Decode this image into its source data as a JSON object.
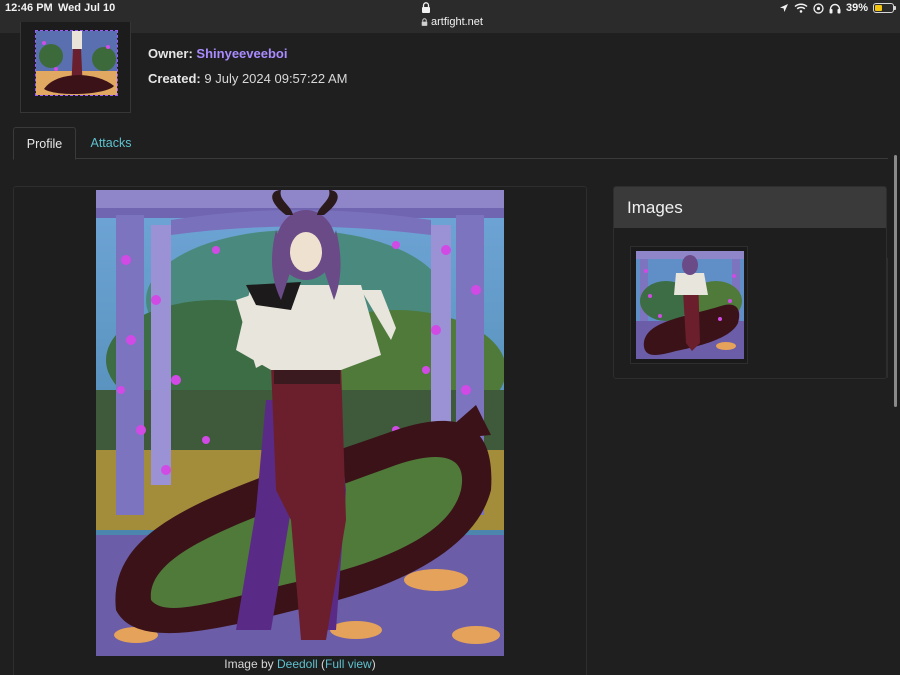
{
  "status_bar": {
    "time": "12:46 PM",
    "date": "Wed Jul 10",
    "url": "artfight.net",
    "battery": "39%",
    "battery_level": 0.39,
    "icons": [
      "location-icon",
      "wifi-icon",
      "hotspot-icon",
      "headphones-icon",
      "battery-icon",
      "lock-icon"
    ]
  },
  "header": {
    "owner_label": "Owner:",
    "owner_name": "Shinyeeveeboi",
    "created_label": "Created:",
    "created_value": "9 July 2024 09:57:22 AM"
  },
  "tabs": [
    {
      "label": "Profile",
      "active": true
    },
    {
      "label": "Attacks",
      "active": false
    }
  ],
  "main": {
    "caption_prefix": "Image by ",
    "artist": "Deedoll",
    "full_view": "Full view",
    "paren_open": "(",
    "paren_close": ")"
  },
  "sidebar": {
    "title": "Images"
  },
  "colors": {
    "accent_link": "#5fc1cf",
    "owner_link": "#a98bff",
    "background": "#1f1f1f"
  }
}
